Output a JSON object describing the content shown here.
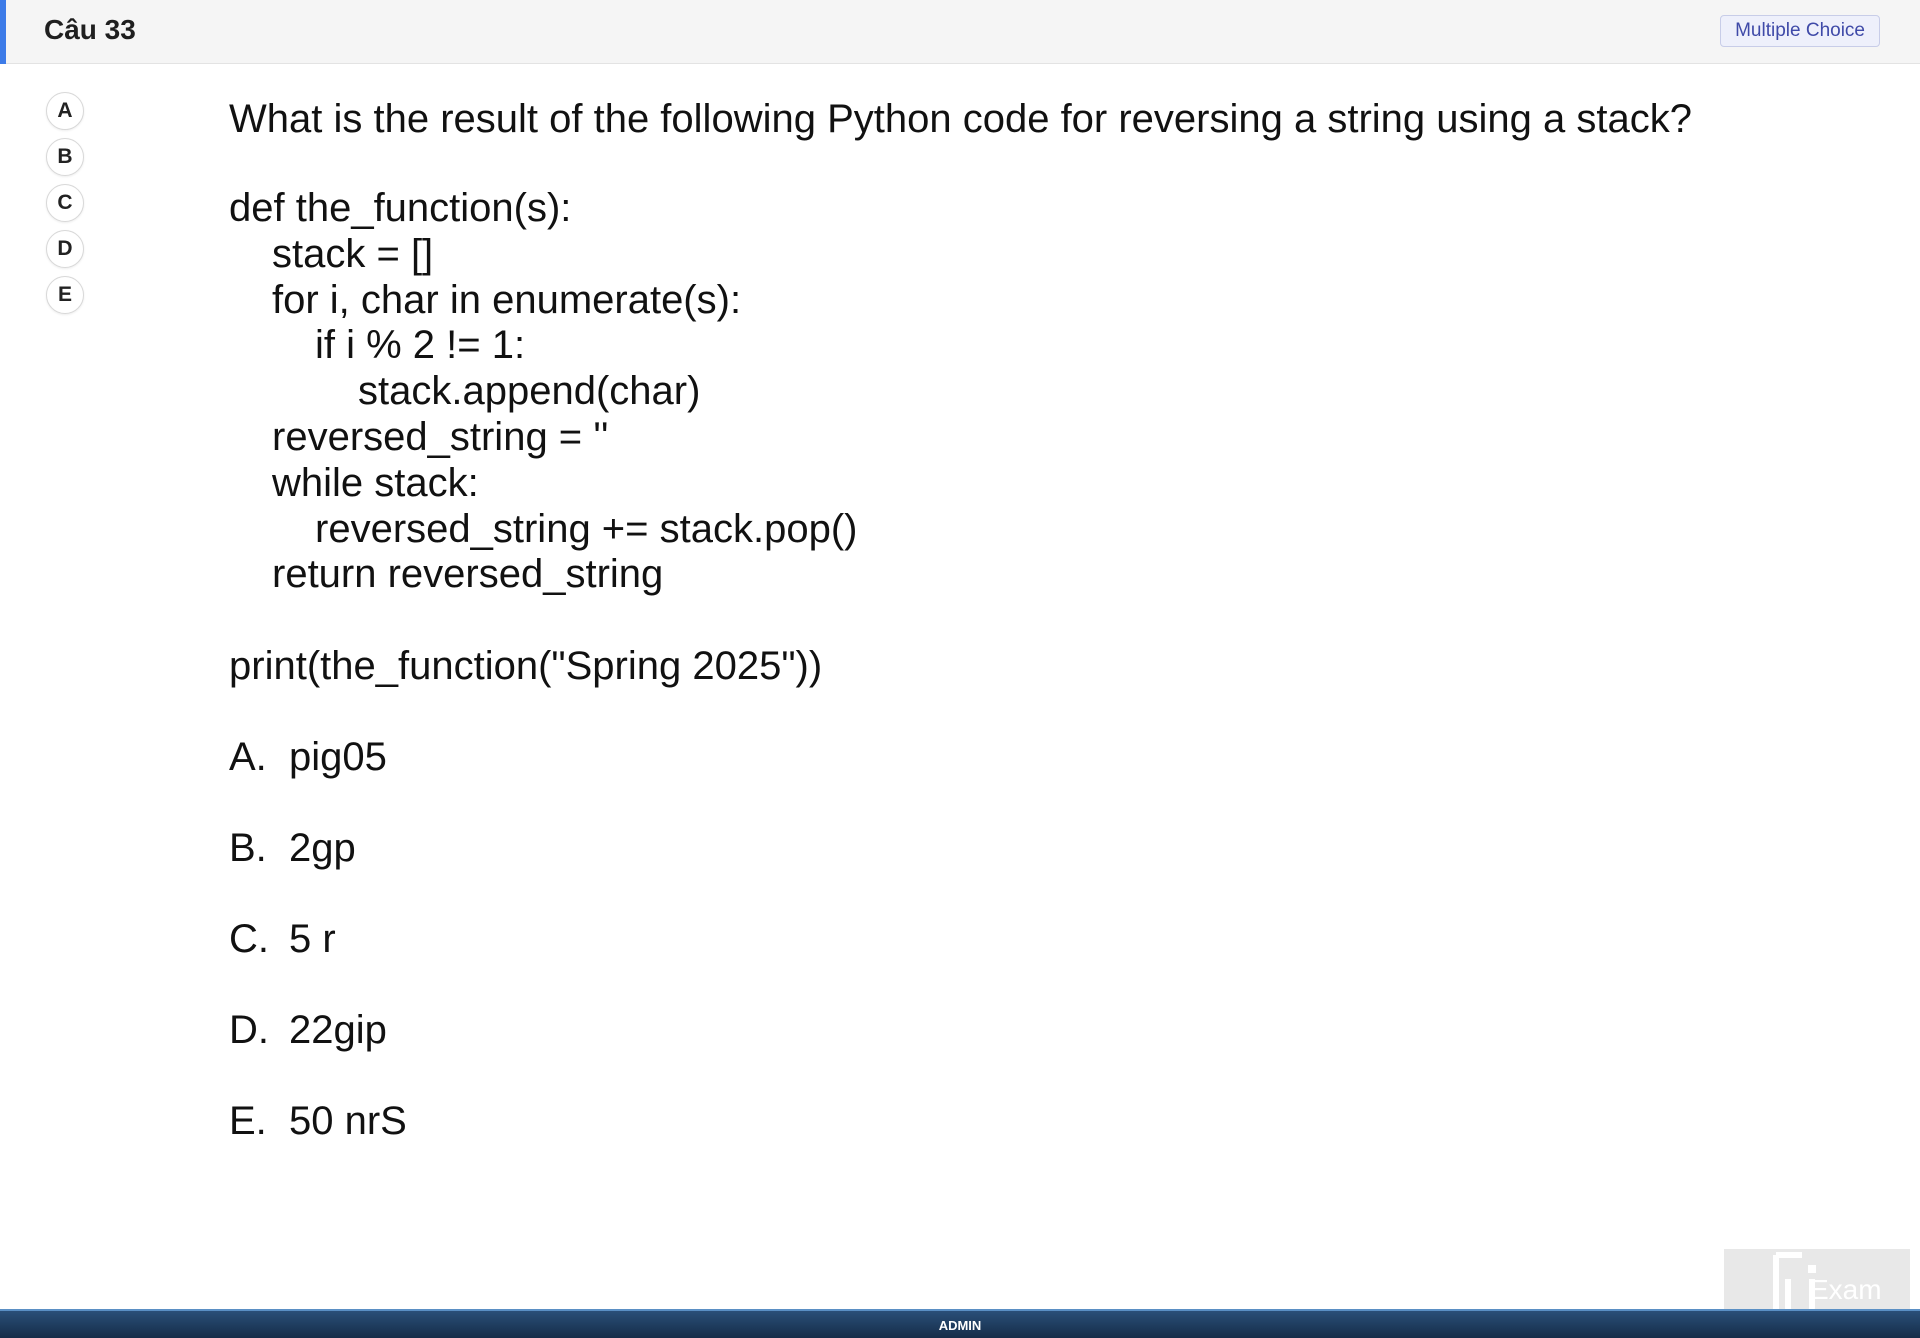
{
  "header": {
    "question_title": "Câu 33",
    "question_type": "Multiple Choice"
  },
  "answer_selectors": [
    "A",
    "B",
    "C",
    "D",
    "E"
  ],
  "question": {
    "stem": "What is the result of the following Python code for reversing a string using a stack?",
    "code_lines": [
      "def the_function(s):",
      "stack = []",
      "for i, char in enumerate(s):",
      "if i % 2 != 1:",
      "stack.append(char)",
      "reversed_string = ''",
      "while stack:",
      "reversed_string += stack.pop()",
      "return reversed_string"
    ],
    "print_line": "print(the_function(\"Spring 2025\"))",
    "options": [
      {
        "letter": "A.",
        "text": "pig05"
      },
      {
        "letter": "B.",
        "text": "2gp"
      },
      {
        "letter": "C.",
        "text": "5 r"
      },
      {
        "letter": "D.",
        "text": "22gip"
      },
      {
        "letter": "E.",
        "text": "50 nrS"
      }
    ]
  },
  "footer": {
    "label": "ADMIN"
  },
  "logo": {
    "text": "Exam"
  }
}
